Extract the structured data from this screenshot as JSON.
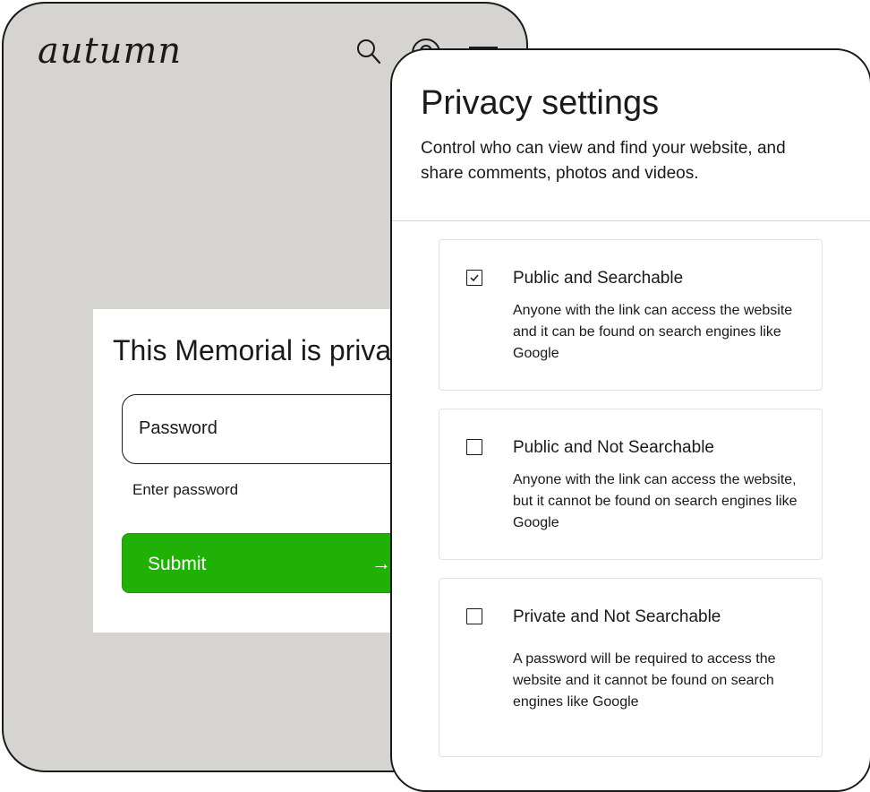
{
  "brand": {
    "logo_text": "autumn"
  },
  "header": {
    "icons": [
      "search-icon",
      "location-icon",
      "menu-icon"
    ]
  },
  "lock_screen": {
    "title": "This Memorial is private",
    "password_label": "Password",
    "password_helper": "Enter password",
    "submit_label": "Submit",
    "submit_arrow": "→",
    "submit_color": "#21b005"
  },
  "privacy": {
    "title": "Privacy settings",
    "description": "Control who can view and find your website, and share comments, photos and videos.",
    "options": [
      {
        "label": "Public and Searchable",
        "description": "Anyone with the link can access the website and it can be found on search engines like Google",
        "checked": true
      },
      {
        "label": "Public and Not Searchable",
        "description": "Anyone with the link can access the website, but it cannot be found on search engines like Google",
        "checked": false
      },
      {
        "label": "Private and Not Searchable",
        "description": "A password will be required to access the website and it cannot be found on search engines like Google",
        "checked": false
      }
    ]
  },
  "colors": {
    "back_phone_bg": "#d5d4d0",
    "accent_green": "#21b005"
  }
}
